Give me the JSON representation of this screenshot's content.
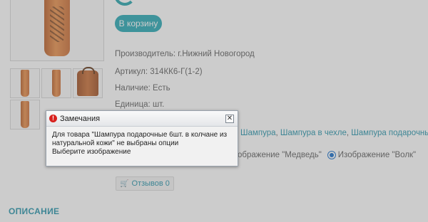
{
  "product": {
    "cart_button": "В корзину",
    "manufacturer": "Производитель: г.Нижний Новогород",
    "article": "Артикул: 314КК6-Г(1-2)",
    "availability": "Наличие: Есть",
    "unit": "Единица: шт.",
    "related_links": [
      "Шампура",
      "Шампура в чехле",
      "Шампура подарочные"
    ],
    "options": {
      "option_1": "ображение \"Медведь\"",
      "option_2": "Изображение \"Волк\"",
      "selected": "option_2"
    },
    "reviews_button": "Отзывов 0",
    "description_tab": "ОПИСАНИЕ"
  },
  "dialog": {
    "title": "Замечания",
    "message_line_1": "Для товара \"Шампура подарочные 6шт. в колчане из",
    "message_line_2": "натуральной кожи\" не выбраны опции",
    "message_line_3": "Выберите изображение",
    "close_glyph": "✕"
  },
  "colors": {
    "accent": "#1ba3b0",
    "link": "#1b8ea6",
    "error": "#d8211d"
  }
}
